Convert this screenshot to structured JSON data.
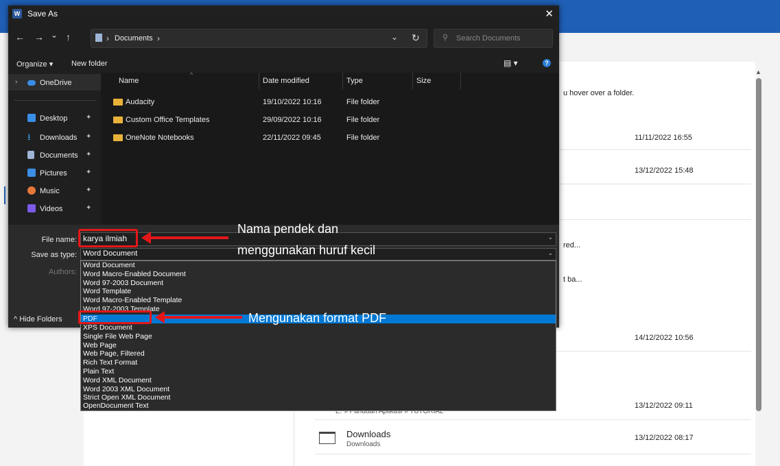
{
  "background": {
    "hint_text": "u hover over a folder.",
    "rows": [
      {
        "date": "11/11/2022 16:55"
      },
      {
        "date": "13/12/2022 15:48"
      },
      {
        "date": "14/12/2022 10:56"
      },
      {
        "date": "13/12/2022 09:11",
        "path": "E: » Panduan Aplikasi » TUTORIAL"
      },
      {
        "date": "13/12/2022 08:17",
        "name": "Downloads",
        "sub": "Downloads"
      }
    ],
    "truncated1": "red...",
    "truncated2": "t ba..."
  },
  "dialog": {
    "title": "Save As",
    "close": "✕",
    "nav": {
      "back": "←",
      "forward": "→",
      "down": "⌄",
      "up": "↑"
    },
    "address": {
      "sep1": "›",
      "crumb": "Documents",
      "sep2": "›",
      "dropdown": "⌄",
      "refresh": "↻"
    },
    "search_placeholder": "Search Documents",
    "toolbar": {
      "organize": "Organize ▾",
      "new_folder": "New folder",
      "view": "▤ ▾",
      "help": "?"
    },
    "sidebar": [
      {
        "label": "OneDrive",
        "icon": "cloud-icon",
        "color": "#3a8ee6"
      },
      {
        "label": "Desktop",
        "icon": "desktop-icon",
        "color": "#3a8ee6"
      },
      {
        "label": "Downloads",
        "icon": "download-icon",
        "color": "#3aa0e6"
      },
      {
        "label": "Documents",
        "icon": "document-icon",
        "color": "#9db4d6"
      },
      {
        "label": "Pictures",
        "icon": "picture-icon",
        "color": "#3a8ee6"
      },
      {
        "label": "Music",
        "icon": "music-icon",
        "color": "#e6783a"
      },
      {
        "label": "Videos",
        "icon": "video-icon",
        "color": "#7a5ae6"
      }
    ],
    "columns": {
      "name": "Name",
      "date": "Date modified",
      "type": "Type",
      "size": "Size"
    },
    "files": [
      {
        "name": "Audacity",
        "date": "19/10/2022 10:16",
        "type": "File folder"
      },
      {
        "name": "Custom Office Templates",
        "date": "29/09/2022 10:16",
        "type": "File folder"
      },
      {
        "name": "OneNote Notebooks",
        "date": "22/11/2022 09:45",
        "type": "File folder"
      }
    ],
    "form": {
      "file_name_label": "File name:",
      "file_name_value": "karya ilmiah",
      "save_type_label": "Save as type:",
      "save_type_value": "Word Document",
      "authors_label": "Authors:",
      "hide_folders": "^  Hide Folders"
    },
    "save_types": [
      "Word Document",
      "Word Macro-Enabled Document",
      "Word 97-2003 Document",
      "Word Template",
      "Word Macro-Enabled Template",
      "Word 97-2003 Template",
      "PDF",
      "XPS Document",
      "Single File Web Page",
      "Web Page",
      "Web Page, Filtered",
      "Rich Text Format",
      "Plain Text",
      "Word XML Document",
      "Word 2003 XML Document",
      "Strict Open XML Document",
      "OpenDocument Text"
    ]
  },
  "annotations": {
    "note1_line1": "Nama pendek dan",
    "note1_line2": "menggunakan huruf kecil",
    "note2": "Mengunakan format PDF",
    "color": "#e3171a"
  }
}
